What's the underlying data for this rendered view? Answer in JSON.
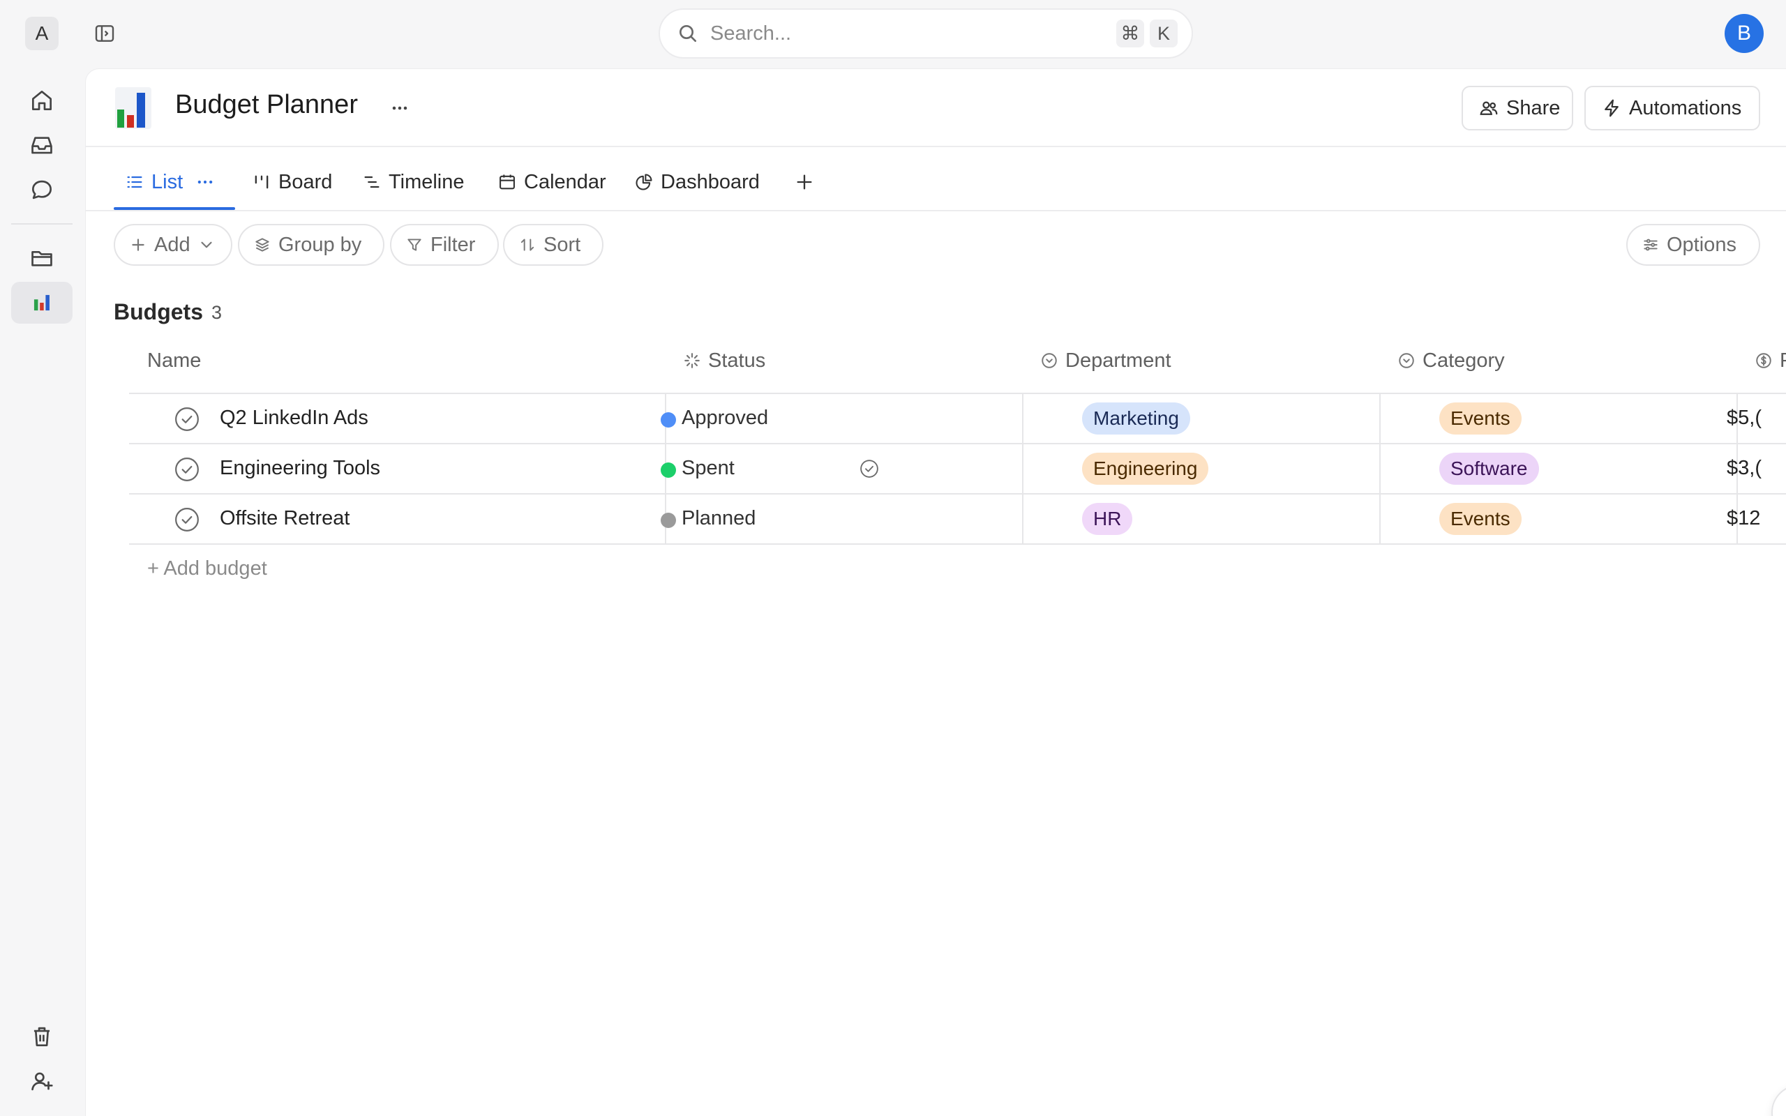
{
  "topbar": {
    "workspace_initial": "A",
    "search_placeholder": "Search...",
    "shortcut_cmd": "⌘",
    "shortcut_key": "K",
    "user_initial": "B"
  },
  "project": {
    "title": "Budget Planner",
    "share_label": "Share",
    "automations_label": "Automations"
  },
  "tabs": [
    {
      "label": "List",
      "icon": "list-icon",
      "active": true
    },
    {
      "label": "Board",
      "icon": "board-icon"
    },
    {
      "label": "Timeline",
      "icon": "timeline-icon"
    },
    {
      "label": "Calendar",
      "icon": "calendar-icon"
    },
    {
      "label": "Dashboard",
      "icon": "dashboard-icon"
    }
  ],
  "toolbar": {
    "add_label": "Add",
    "group_label": "Group by",
    "filter_label": "Filter",
    "sort_label": "Sort",
    "options_label": "Options"
  },
  "section": {
    "title": "Budgets",
    "count": "3"
  },
  "columns": {
    "name": "Name",
    "status": "Status",
    "department": "Department",
    "category": "Category",
    "price_partial": "P"
  },
  "rows": [
    {
      "name": "Q2 LinkedIn Ads",
      "status": "Approved",
      "department": "Marketing",
      "category": "Events",
      "amount": "$5,("
    },
    {
      "name": "Engineering Tools",
      "status": "Spent",
      "department": "Engineering",
      "category": "Software",
      "amount": "$3,("
    },
    {
      "name": "Offsite Retreat",
      "status": "Planned",
      "department": "HR",
      "category": "Events",
      "amount": "$12"
    }
  ],
  "add_row_label": "+ Add budget",
  "colors": {
    "accent": "#2a6be0",
    "status_approved": "#4f8ef7",
    "status_spent": "#1ccf6a",
    "status_planned": "#9a9a9a",
    "tag_marketing_bg": "#d6e4fb",
    "tag_engineering_bg": "#fde2c4",
    "tag_hr_bg": "#f0d8f9",
    "tag_events_bg": "#fde2c4",
    "tag_software_bg": "#ecd5f8"
  }
}
